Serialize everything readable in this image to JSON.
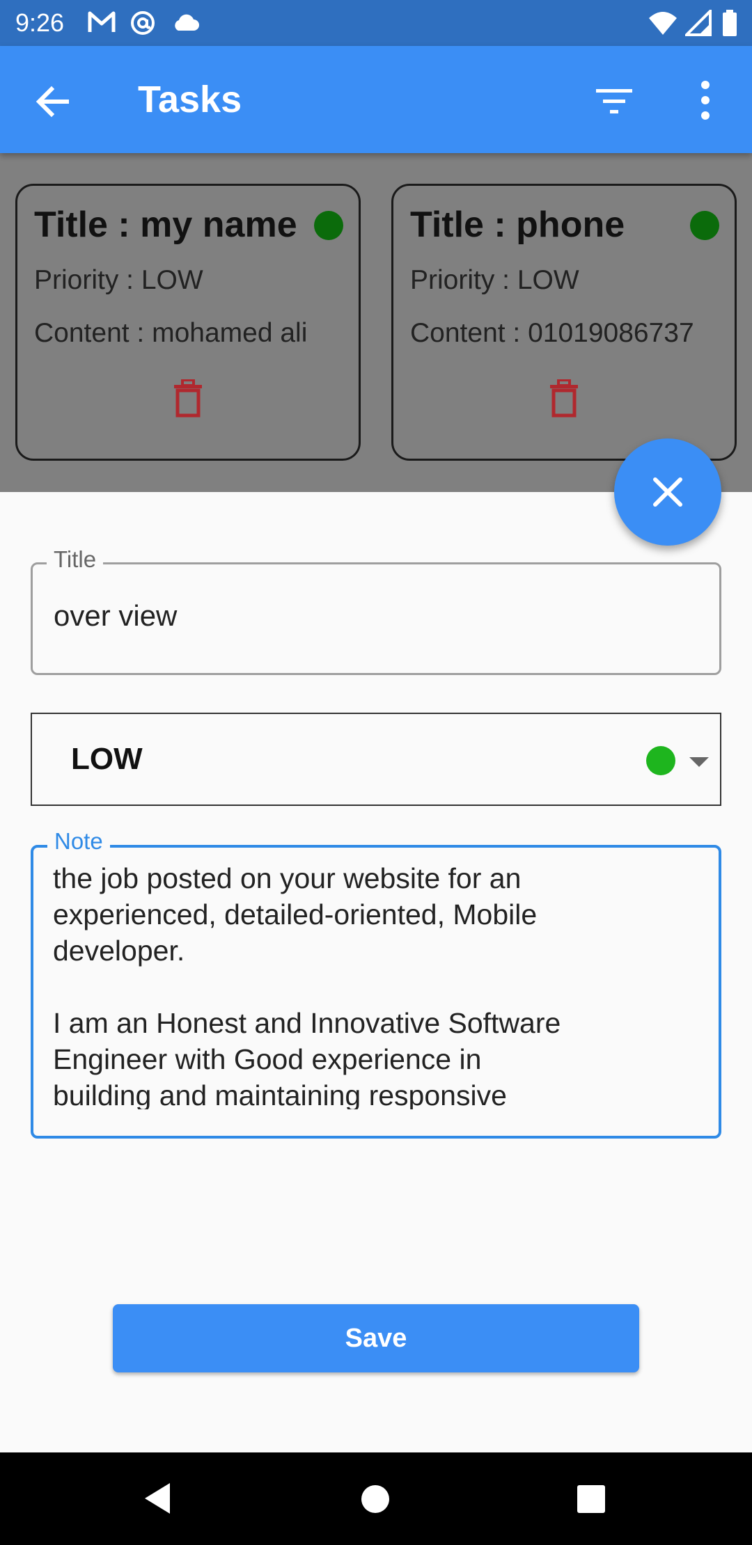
{
  "status_bar": {
    "time": "9:26",
    "icons": [
      "gmail-icon",
      "at-sign-icon",
      "cloud-icon",
      "wifi-icon",
      "signal-icon",
      "battery-icon"
    ]
  },
  "app_bar": {
    "title": "Tasks",
    "icons": [
      "back-arrow-icon",
      "filter-icon",
      "more-vert-icon"
    ]
  },
  "tasks": [
    {
      "title": "Title : my name",
      "priority": "Priority : LOW",
      "content": "Content : mohamed ali",
      "status_color": "#0b6b0b"
    },
    {
      "title": "Title : phone",
      "priority": "Priority : LOW",
      "content": "Content : 01019086737",
      "status_color": "#0b6b0b"
    }
  ],
  "form": {
    "title_label": "Title",
    "title_value": "over view",
    "priority_value": "LOW",
    "priority_color": "#1eb51e",
    "note_label": "Note",
    "note_value": "the job posted on your website for an\nexperienced, detailed-oriented, Mobile\ndeveloper.\n\nI am an Honest and Innovative Software\nEngineer with Good experience in\nbuilding and maintaining responsive",
    "save_label": "Save"
  },
  "colors": {
    "primary": "#3b8ef5",
    "status_bar": "#2f6fbf",
    "focus": "#2f8ae6",
    "delete": "#b0282e"
  }
}
